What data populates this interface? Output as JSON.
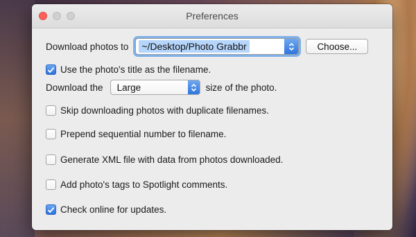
{
  "window": {
    "title": "Preferences"
  },
  "download": {
    "label": "Download photos to",
    "path_value": "~/Desktop/Photo Grabbr",
    "choose_label": "Choose..."
  },
  "options": {
    "use_title": {
      "label": "Use the photo's title as the filename.",
      "checked": true
    },
    "size_prefix": "Download the",
    "size_value": "Large",
    "size_suffix": "size of the photo.",
    "skip_duplicates": {
      "label": "Skip downloading photos with duplicate filenames.",
      "checked": false
    },
    "prepend_number": {
      "label": "Prepend sequential number to filename.",
      "checked": false
    },
    "generate_xml": {
      "label": "Generate XML file with data from photos downloaded.",
      "checked": false
    },
    "spotlight_tags": {
      "label": "Add photo's tags to Spotlight comments.",
      "checked": false
    },
    "check_updates": {
      "label": "Check online for updates.",
      "checked": true
    }
  },
  "icons": {
    "stepper": "up-down-chevron-icon",
    "checkmark": "checkmark-icon"
  },
  "colors": {
    "accent": "#2e72dc",
    "selection": "#b5d5fb",
    "close_light": "#fc605c"
  }
}
